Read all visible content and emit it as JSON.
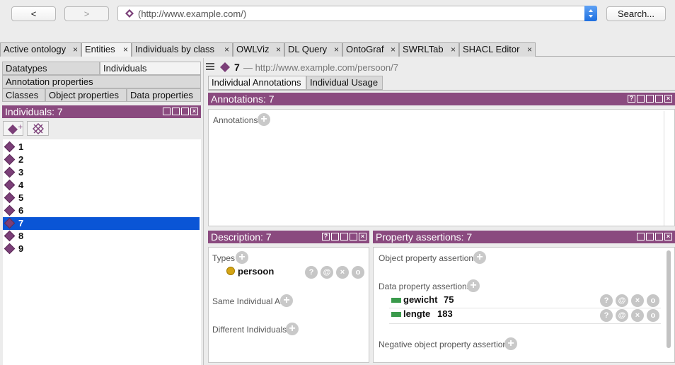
{
  "toolbar": {
    "back_label": "<",
    "forward_label": ">",
    "url": "(http://www.example.com/)",
    "search_label": "Search..."
  },
  "tabs": [
    {
      "label": "Active ontology"
    },
    {
      "label": "Entities"
    },
    {
      "label": "Individuals by class"
    },
    {
      "label": "OWLViz"
    },
    {
      "label": "DL Query"
    },
    {
      "label": "OntoGraf"
    },
    {
      "label": "SWRLTab"
    },
    {
      "label": "SHACL Editor"
    }
  ],
  "tab_close": "×",
  "left": {
    "subtabs": [
      "Datatypes",
      "Individuals",
      "Annotation properties",
      "Classes",
      "Object properties",
      "Data properties"
    ],
    "individuals_header": "Individuals: 7",
    "items": [
      "1",
      "2",
      "3",
      "4",
      "5",
      "6",
      "7",
      "8",
      "9"
    ],
    "selected_index": 6
  },
  "right": {
    "breadcrumb_name": "7",
    "breadcrumb_iri": "— http://www.example.com/persoon/7",
    "subtabs": [
      "Individual Annotations",
      "Individual Usage"
    ],
    "annotations_header": "Annotations: 7",
    "annotations_label": "Annotations",
    "description_header": "Description: 7",
    "types_label": "Types",
    "type_value": "persoon",
    "same_label": "Same Individual As",
    "different_label": "Different Individuals",
    "property_header": "Property assertions: 7",
    "object_prop_label": "Object property assertions",
    "data_prop_label": "Data property assertions",
    "data_props": [
      {
        "name": "gewicht",
        "value": "75"
      },
      {
        "name": "lengte",
        "value": "183"
      }
    ],
    "negative_label": "Negative object property assertions"
  },
  "colors": {
    "accent": "#8a4a7f",
    "selection": "#0a55d6"
  }
}
